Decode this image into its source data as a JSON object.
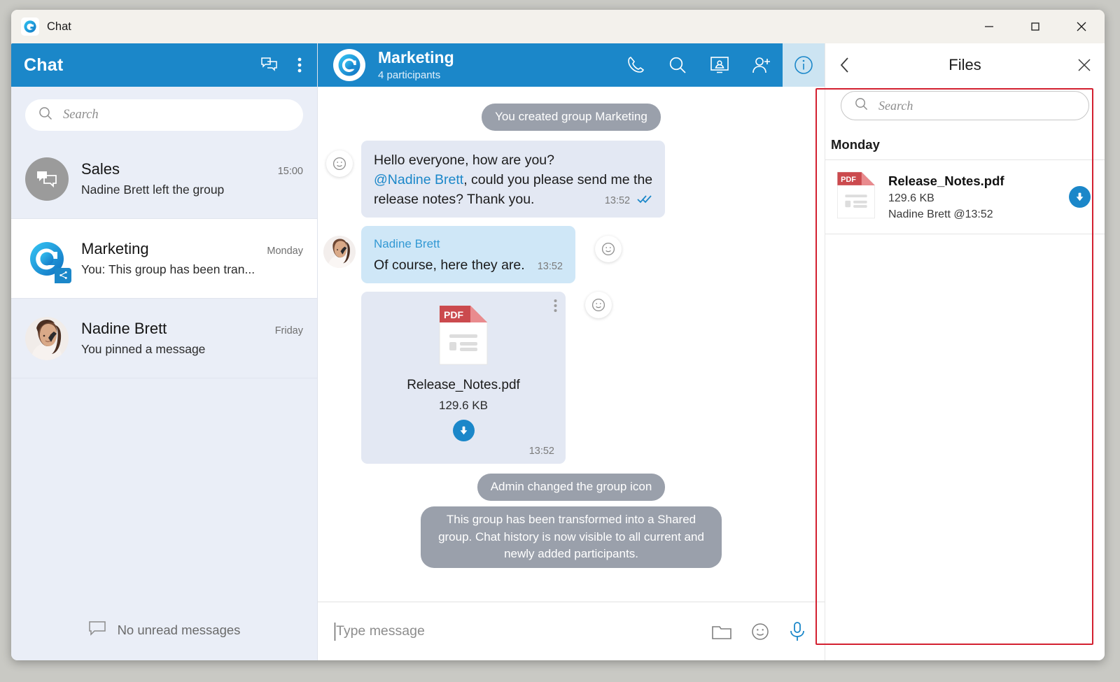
{
  "window": {
    "title": "Chat",
    "app_icon": "chat-app-logo-icon",
    "controls": {
      "minimize": "minimize-icon",
      "maximize": "maximize-icon",
      "close": "close-icon"
    }
  },
  "sidebar": {
    "header": {
      "title": "Chat",
      "new_chat_icon": "new-chat-icon",
      "more_icon": "more-vertical-icon"
    },
    "search": {
      "placeholder": "Search",
      "icon": "search-icon"
    },
    "chats": [
      {
        "name": "Sales",
        "time": "15:00",
        "preview": "Nadine Brett left the group",
        "avatar_type": "group-chat-icon",
        "active": false,
        "shared": false
      },
      {
        "name": "Marketing",
        "time": "Monday",
        "preview": "You: This group has been tran...",
        "avatar_type": "marketing-logo-icon",
        "active": true,
        "shared": true
      },
      {
        "name": "Nadine Brett",
        "time": "Friday",
        "preview": "You pinned a message",
        "avatar_type": "person-photo",
        "active": false,
        "shared": false
      }
    ],
    "footer": {
      "label": "No unread messages",
      "icon": "speech-bubble-icon"
    }
  },
  "chat_header": {
    "title": "Marketing",
    "subtitle": "4 participants",
    "avatar": "marketing-logo-icon",
    "actions": [
      {
        "name": "call-icon",
        "label": "Call",
        "active": false
      },
      {
        "name": "search-icon",
        "label": "Search",
        "active": false
      },
      {
        "name": "screen-share-icon",
        "label": "Screen share",
        "active": false
      },
      {
        "name": "add-participant-icon",
        "label": "Add participant",
        "active": false
      },
      {
        "name": "info-icon",
        "label": "Info",
        "active": true
      }
    ]
  },
  "conversation": {
    "items": [
      {
        "type": "system",
        "text": "You created group Marketing"
      },
      {
        "type": "outgoing",
        "line1": "Hello everyone, how are you?",
        "mention": "@Nadine Brett",
        "line2_rest": ", could you please send me the",
        "line3": "release notes? Thank you.",
        "time": "13:52",
        "status": "read",
        "reaction_icon": "emoji-reaction-icon"
      },
      {
        "type": "incoming",
        "sender": "Nadine Brett",
        "text": "Of course, here they are.",
        "time": "13:52",
        "reaction_icon": "emoji-reaction-icon"
      },
      {
        "type": "file",
        "file_label": "PDF",
        "file_name": "Release_Notes.pdf",
        "file_size": "129.6 KB",
        "time": "13:52",
        "download_icon": "download-icon",
        "menu_icon": "more-vertical-icon",
        "reaction_icon": "emoji-reaction-icon"
      },
      {
        "type": "system",
        "text": "Admin changed the group icon"
      },
      {
        "type": "system",
        "text": "This group has been transformed into a Shared group. Chat history is now visible to all current and newly added participants."
      }
    ]
  },
  "composer": {
    "placeholder": "Type message",
    "icons": [
      {
        "name": "attach-folder-icon"
      },
      {
        "name": "emoji-icon"
      },
      {
        "name": "microphone-icon"
      }
    ]
  },
  "files_panel": {
    "title": "Files",
    "back_icon": "chevron-left-icon",
    "close_icon": "close-icon",
    "search": {
      "placeholder": "Search",
      "icon": "search-icon"
    },
    "groups": [
      {
        "day": "Monday",
        "files": [
          {
            "badge": "PDF",
            "name": "Release_Notes.pdf",
            "size": "129.6 KB",
            "meta": "Nadine Brett @13:52",
            "download_icon": "download-icon"
          }
        ]
      }
    ]
  },
  "colors": {
    "brand_blue": "#1b87c9",
    "sidebar_bg": "#eaeef7",
    "outgoing_bubble": "#e3e8f3",
    "incoming_bubble": "#cfe7f7",
    "system_pill": "#9aa0ab",
    "pdf_red": "#d24b4b",
    "highlight": "#d32030"
  }
}
